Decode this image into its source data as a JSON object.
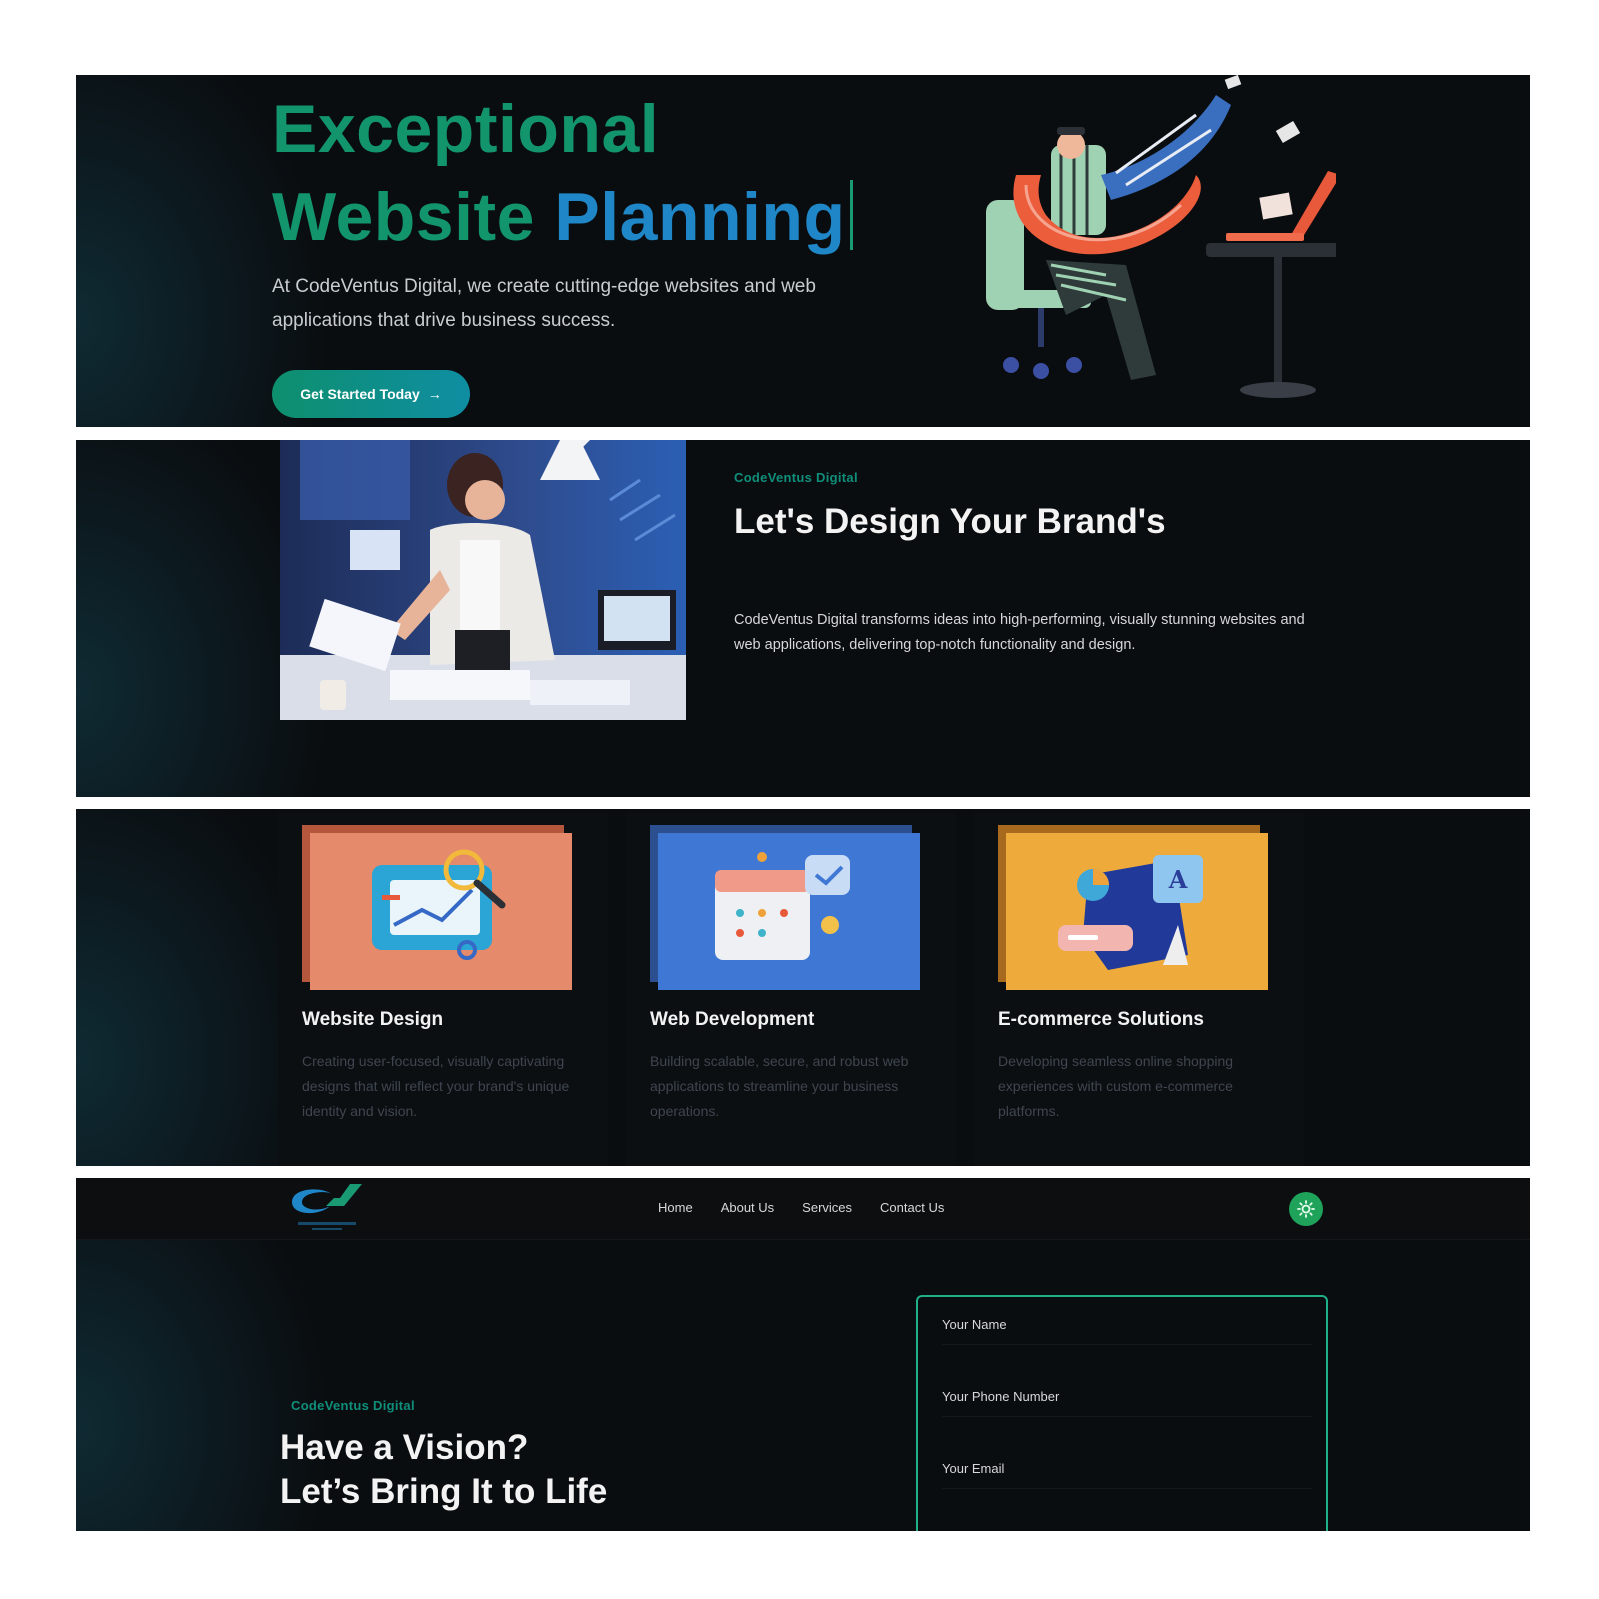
{
  "hero": {
    "title_line1": "Exceptional",
    "title_line2_word1": "Website",
    "title_line2_word2": "Planning",
    "subtitle": "At CodeVentus Digital, we create cutting-edge websites and web applications that drive business success.",
    "cta_label": "Get Started Today",
    "cta_arrow": "→",
    "illustration_icon": "person-at-desk-illustration"
  },
  "about": {
    "eyebrow": "CodeVentus Digital",
    "title": "Let's Design Your Brand's",
    "text": "CodeVentus Digital transforms ideas into high-performing, visually stunning websites and web applications, delivering top-notch functionality and design.",
    "photo_icon": "woman-designer-photo"
  },
  "services": {
    "items": [
      {
        "title": "Website Design",
        "description": "Creating user-focused, visually captivating designs that will reflect your brand's unique identity and vision.",
        "bg": "#e58a6a",
        "icon": "chart-magnifier-icon"
      },
      {
        "title": "Web Development",
        "description": "Building scalable, secure, and robust web applications to streamline your business operations.",
        "bg": "#3f78d4",
        "icon": "calendar-check-icon"
      },
      {
        "title": "E-commerce Solutions",
        "description": "Developing seamless online shopping experiences with custom e-commerce platforms.",
        "bg": "#eeab3c",
        "icon": "shopping-shapes-icon"
      }
    ]
  },
  "contact": {
    "nav": [
      {
        "label": "Home"
      },
      {
        "label": "About Us"
      },
      {
        "label": "Services"
      },
      {
        "label": "Contact Us"
      }
    ],
    "eyebrow": "CodeVentus Digital",
    "title_line1": "Have a Vision?",
    "title_line2": "Let’s Bring It to Life",
    "form": {
      "name_placeholder": "Your Name",
      "phone_placeholder": "Your Phone Number",
      "email_placeholder": "Your Email"
    },
    "colors": {
      "accent": "#1fb08a",
      "toggle": "#1fa35a"
    }
  }
}
